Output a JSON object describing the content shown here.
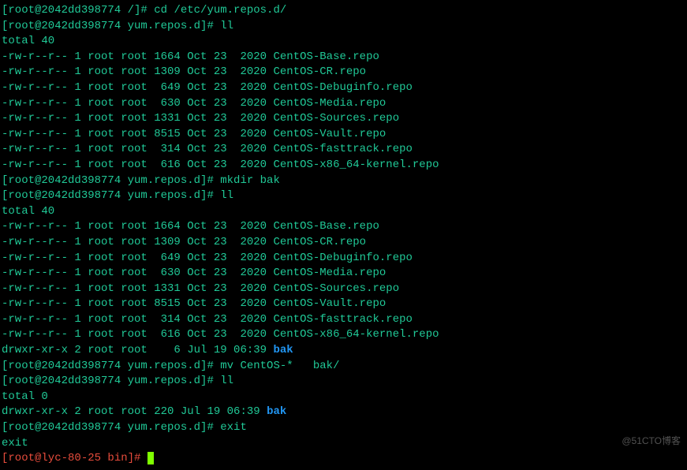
{
  "prompts": {
    "p1": "[root@2042dd398774 /]# ",
    "p2": "[root@2042dd398774 yum.repos.d]# ",
    "local": "[root@lyc-80-25 bin]# "
  },
  "commands": {
    "cd": "cd /etc/yum.repos.d/",
    "ll": "ll",
    "mkdir": "mkdir bak",
    "mv": "mv CentOS-*   bak/",
    "exit": "exit"
  },
  "totals": {
    "t40": "total 40",
    "t0": "total 0"
  },
  "files": {
    "f1": {
      "perm": "-rw-r--r-- 1 root root 1664 Oct 23  2020 ",
      "name": "CentOS-Base.repo"
    },
    "f2": {
      "perm": "-rw-r--r-- 1 root root 1309 Oct 23  2020 ",
      "name": "CentOS-CR.repo"
    },
    "f3": {
      "perm": "-rw-r--r-- 1 root root  649 Oct 23  2020 ",
      "name": "CentOS-Debuginfo.repo"
    },
    "f4": {
      "perm": "-rw-r--r-- 1 root root  630 Oct 23  2020 ",
      "name": "CentOS-Media.repo"
    },
    "f5": {
      "perm": "-rw-r--r-- 1 root root 1331 Oct 23  2020 ",
      "name": "CentOS-Sources.repo"
    },
    "f6": {
      "perm": "-rw-r--r-- 1 root root 8515 Oct 23  2020 ",
      "name": "CentOS-Vault.repo"
    },
    "f7": {
      "perm": "-rw-r--r-- 1 root root  314 Oct 23  2020 ",
      "name": "CentOS-fasttrack.repo"
    },
    "f8": {
      "perm": "-rw-r--r-- 1 root root  616 Oct 23  2020 ",
      "name": "CentOS-x86_64-kernel.repo"
    }
  },
  "dirs": {
    "bak6": {
      "perm": "drwxr-xr-x 2 root root    6 Jul 19 06:39 ",
      "name": "bak"
    },
    "bak220": {
      "perm": "drwxr-xr-x 2 root root 220 Jul 19 06:39 ",
      "name": "bak"
    }
  },
  "exit_echo": "exit",
  "watermark": "@51CTO博客"
}
